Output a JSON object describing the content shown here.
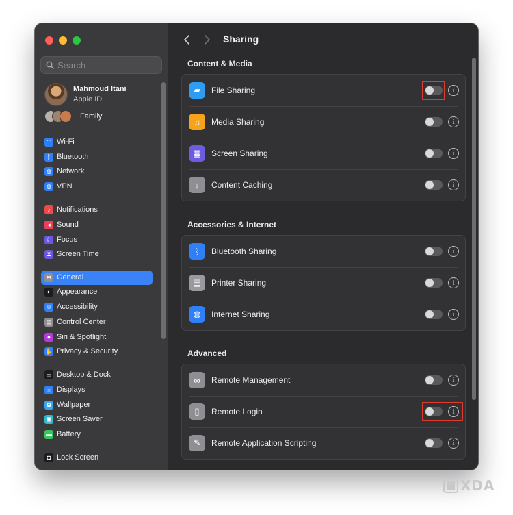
{
  "window": {
    "title": "Sharing"
  },
  "sidebar": {
    "search_placeholder": "Search",
    "account": {
      "name": "Mahmoud Itani",
      "subtitle": "Apple ID"
    },
    "family_label": "Family",
    "items": [
      {
        "label": "Wi-Fi",
        "icon": "wifi-icon",
        "color": "#2f7ff6"
      },
      {
        "label": "Bluetooth",
        "icon": "bluetooth-icon",
        "color": "#2f7ff6"
      },
      {
        "label": "Network",
        "icon": "globe-icon",
        "color": "#2f7ff6"
      },
      {
        "label": "VPN",
        "icon": "vpn-globe-icon",
        "color": "#2f7ff6"
      },
      {
        "label": "Notifications",
        "icon": "bell-icon",
        "color": "#ef4a4a"
      },
      {
        "label": "Sound",
        "icon": "speaker-icon",
        "color": "#ef3e5a"
      },
      {
        "label": "Focus",
        "icon": "moon-icon",
        "color": "#6b58e0"
      },
      {
        "label": "Screen Time",
        "icon": "hourglass-icon",
        "color": "#6b58e0"
      },
      {
        "label": "General",
        "icon": "gear-icon",
        "color": "#8e8e93",
        "selected": true
      },
      {
        "label": "Appearance",
        "icon": "appearance-icon",
        "color": "#1c1c1e"
      },
      {
        "label": "Accessibility",
        "icon": "accessibility-icon",
        "color": "#2f7ff6"
      },
      {
        "label": "Control Center",
        "icon": "control-center-icon",
        "color": "#8e8e93"
      },
      {
        "label": "Siri & Spotlight",
        "icon": "siri-icon",
        "color": "#b43ad9"
      },
      {
        "label": "Privacy & Security",
        "icon": "hand-icon",
        "color": "#2f7ff6"
      },
      {
        "label": "Desktop & Dock",
        "icon": "dock-icon",
        "color": "#1c1c1e"
      },
      {
        "label": "Displays",
        "icon": "sun-icon",
        "color": "#2f7ff6"
      },
      {
        "label": "Wallpaper",
        "icon": "flower-icon",
        "color": "#35a7f0"
      },
      {
        "label": "Screen Saver",
        "icon": "screen-saver-icon",
        "color": "#36b7c9"
      },
      {
        "label": "Battery",
        "icon": "battery-icon",
        "color": "#34c759"
      },
      {
        "label": "Lock Screen",
        "icon": "lock-icon",
        "color": "#1c1c1e"
      }
    ]
  },
  "main": {
    "title": "Sharing",
    "sections": [
      {
        "title": "Content & Media",
        "rows": [
          {
            "label": "File Sharing",
            "icon": "folder-icon",
            "color": "#2d9cf2",
            "enabled": false,
            "highlighted": true
          },
          {
            "label": "Media Sharing",
            "icon": "media-icon",
            "color": "#f7a21b",
            "enabled": false
          },
          {
            "label": "Screen Sharing",
            "icon": "screen-sharing-icon",
            "color": "#6d5ce0",
            "enabled": false
          },
          {
            "label": "Content Caching",
            "icon": "caching-icon",
            "color": "#8e8e93",
            "enabled": false
          }
        ]
      },
      {
        "title": "Accessories & Internet",
        "rows": [
          {
            "label": "Bluetooth Sharing",
            "icon": "bluetooth-icon",
            "color": "#2f7ff6",
            "enabled": false
          },
          {
            "label": "Printer Sharing",
            "icon": "printer-icon",
            "color": "#9a9a9e",
            "enabled": false
          },
          {
            "label": "Internet Sharing",
            "icon": "globe-icon",
            "color": "#2f7ff6",
            "enabled": false
          }
        ]
      },
      {
        "title": "Advanced",
        "rows": [
          {
            "label": "Remote Management",
            "icon": "binoculars-icon",
            "color": "#8e8e93",
            "enabled": false
          },
          {
            "label": "Remote Login",
            "icon": "terminal-icon",
            "color": "#8e8e93",
            "enabled": false,
            "highlighted": true
          },
          {
            "label": "Remote Application Scripting",
            "icon": "script-icon",
            "color": "#8e8e93",
            "enabled": false
          }
        ]
      }
    ]
  },
  "watermark": {
    "text": "XDA"
  }
}
